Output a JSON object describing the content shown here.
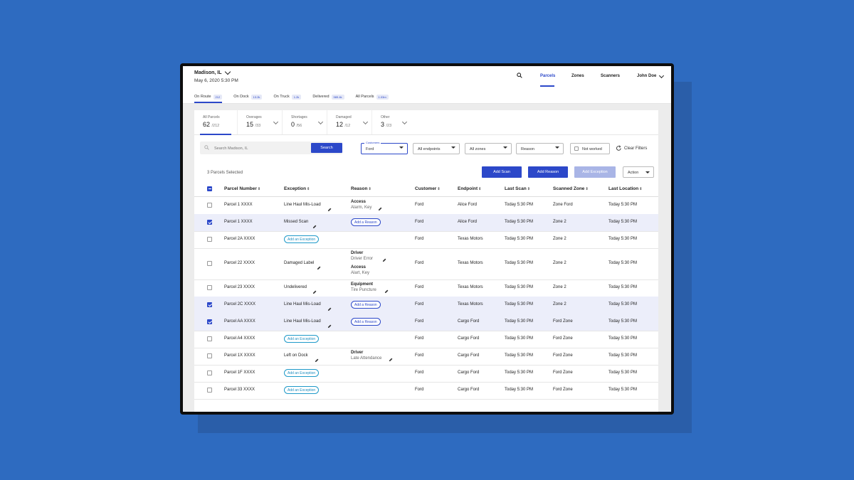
{
  "header": {
    "location": "Madison, IL",
    "date": "May 6, 2020 5:30 PM",
    "nav": [
      "Parcels",
      "Zones",
      "Scanners"
    ],
    "user": "John Doe"
  },
  "tabs": [
    {
      "label": "On Route",
      "badge": "212"
    },
    {
      "label": "On Dock",
      "badge": "13.2k"
    },
    {
      "label": "On Truck",
      "badge": "1.2k"
    },
    {
      "label": "Delivered",
      "badge": "989.4k"
    },
    {
      "label": "All Parcels",
      "badge": "1.03m"
    }
  ],
  "stats": [
    {
      "label": "All Parcels",
      "value": "62",
      "of": "/212"
    },
    {
      "label": "Overages",
      "value": "15",
      "of": "/33"
    },
    {
      "label": "Shortages",
      "value": "0",
      "of": "/56"
    },
    {
      "label": "Damaged",
      "value": "12",
      "of": "/12"
    },
    {
      "label": "Other",
      "value": "3",
      "of": "/23"
    }
  ],
  "filters": {
    "search_placeholder": "Search Madison, IL",
    "search_button": "Search",
    "customers_label": "Customers",
    "customers_value": "Ford",
    "endpoints": "All endpoints",
    "zones": "All zones",
    "reason": "Reason",
    "not_worked": "Not worked",
    "clear": "Clear Filters"
  },
  "actions": {
    "selected": "3 Parcels Selected",
    "add_scan": "Add Scan",
    "add_reason": "Add Reason",
    "add_exception": "Add Exception",
    "action": "Action"
  },
  "columns": [
    "Parcel Number",
    "Exception",
    "Reason",
    "Customer",
    "Endpoint",
    "Last Scan",
    "Scanned Zone",
    "Last Location"
  ],
  "add_exception_label": "Add an Exception",
  "add_reason_label": "Add a Reason",
  "rows": [
    {
      "parcel": "Parcel 1 XXXX",
      "checked": false,
      "exception": "Line Haul Mis-Load",
      "reasons": [
        {
          "title": "Access",
          "sub": "Alarm, Key"
        }
      ],
      "add_reason": false,
      "customer": "Ford",
      "endpoint": "Alice Ford",
      "last_scan": "Today 5:30 PM",
      "zone": "Zone Ford",
      "location": "Today 5:30 PM"
    },
    {
      "parcel": "Parcel 1 XXXX",
      "checked": true,
      "exception": "Missed Scan",
      "reasons": [],
      "add_reason": true,
      "customer": "Ford",
      "endpoint": "Alice Ford",
      "last_scan": "Today 5:30 PM",
      "zone": "Zone 2",
      "location": "Today 5:30 PM"
    },
    {
      "parcel": "Parcel 2A XXXX",
      "checked": false,
      "exception": null,
      "reasons": [],
      "add_reason": false,
      "customer": "Ford",
      "endpoint": "Texas Motors",
      "last_scan": "Today 5:30 PM",
      "zone": "Zone 2",
      "location": "Today 5:30 PM"
    },
    {
      "parcel": "Parcel 22 XXXX",
      "checked": false,
      "exception": "Damaged Label",
      "reasons": [
        {
          "title": "Driver",
          "sub": "Driver Error"
        },
        {
          "title": "Access",
          "sub": "Alart, Key"
        }
      ],
      "add_reason": false,
      "customer": "Ford",
      "endpoint": "Texas Motors",
      "last_scan": "Today 5:30 PM",
      "zone": "Zone 2",
      "location": "Today 5:30 PM"
    },
    {
      "parcel": "Parcel 23 XXXX",
      "checked": false,
      "exception": "Undelivered",
      "reasons": [
        {
          "title": "Equipment",
          "sub": "Tire Puncture"
        }
      ],
      "add_reason": false,
      "customer": "Ford",
      "endpoint": "Texas Motors",
      "last_scan": "Today 5:30 PM",
      "zone": "Zone 2",
      "location": "Today 5:30 PM"
    },
    {
      "parcel": "Parcel 2C XXXX",
      "checked": true,
      "exception": "Line Haul Mis-Load",
      "reasons": [],
      "add_reason": true,
      "customer": "Ford",
      "endpoint": "Texas Motors",
      "last_scan": "Today 5:30 PM",
      "zone": "Zone 2",
      "location": "Today 5:30 PM"
    },
    {
      "parcel": "Parcel AA XXXX",
      "checked": true,
      "exception": "Line Haul Mis-Load",
      "reasons": [],
      "add_reason": true,
      "customer": "Ford",
      "endpoint": "Cargo Ford",
      "last_scan": "Today 5:30 PM",
      "zone": "Ford Zone",
      "location": "Today 5:30 PM"
    },
    {
      "parcel": "Parcel A4 XXXX",
      "checked": false,
      "exception": null,
      "reasons": [],
      "add_reason": false,
      "customer": "Ford",
      "endpoint": "Cargo Ford",
      "last_scan": "Today 5:30 PM",
      "zone": "Ford Zone",
      "location": "Today 5:30 PM"
    },
    {
      "parcel": "Parcel 1X XXXX",
      "checked": false,
      "exception": "Left on Dock",
      "reasons": [
        {
          "title": "Driver",
          "sub": "Late Attendance"
        }
      ],
      "add_reason": false,
      "customer": "Ford",
      "endpoint": "Cargo Ford",
      "last_scan": "Today 5:30 PM",
      "zone": "Ford Zone",
      "location": "Today 5:30 PM"
    },
    {
      "parcel": "Parcel 1F XXXX",
      "checked": false,
      "exception": null,
      "reasons": [],
      "add_reason": false,
      "customer": "Ford",
      "endpoint": "Cargo Ford",
      "last_scan": "Today 5:30 PM",
      "zone": "Ford Zone",
      "location": "Today 5:30 PM"
    },
    {
      "parcel": "Parcel 33 XXXX",
      "checked": false,
      "exception": null,
      "reasons": [],
      "add_reason": false,
      "customer": "Ford",
      "endpoint": "Cargo Ford",
      "last_scan": "Today 5:30 PM",
      "zone": "Ford Zone",
      "location": "Today 5:30 PM"
    }
  ],
  "colors": {
    "primary": "#2c48c9",
    "background": "#2e6bc0",
    "pill": "#1f9ac9",
    "selected_row": "#eceefa"
  }
}
